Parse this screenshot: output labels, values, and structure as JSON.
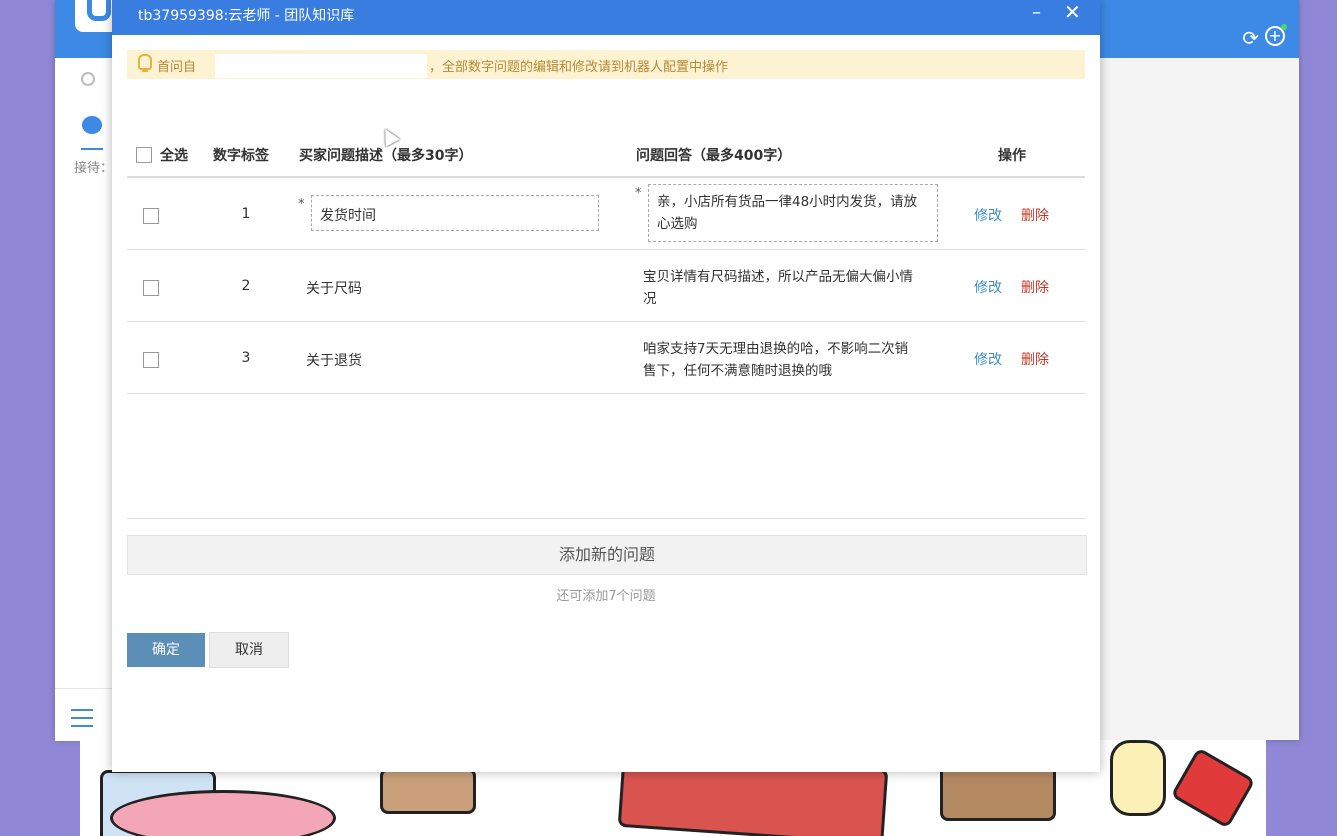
{
  "dialog": {
    "title": "tb37959398:云老师 - 团队知识库",
    "minimize_glyph": "–",
    "close_glyph": "✕"
  },
  "notice": {
    "prefix": "首问自",
    "suffix": "，全部数字问题的编辑和修改请到机器人配置中操作"
  },
  "table": {
    "headers": {
      "select_all": "全选",
      "number_tag": "数字标签",
      "question": "买家问题描述（最多30字）",
      "answer": "问题回答（最多400字）",
      "actions": "操作"
    },
    "required_mark": "*",
    "edit_label": "修改",
    "delete_label": "删除",
    "rows": [
      {
        "num": "1",
        "question": "发货时间",
        "answer": "亲，小店所有货品一律48小时内发货，请放心选购",
        "editing": true
      },
      {
        "num": "2",
        "question": "关于尺码",
        "answer": "宝贝详情有尺码描述，所以产品无偏大偏小情况",
        "editing": false
      },
      {
        "num": "3",
        "question": "关于退货",
        "answer": "咱家支持7天无理由退换的哈，不影响二次销售下，任何不满意随时退换的哦",
        "editing": false
      }
    ]
  },
  "add_button": "添加新的问题",
  "remaining_text": "还可添加7个问题",
  "confirm_button": "确定",
  "cancel_button": "取消",
  "background": {
    "reception_label": "接待：",
    "refresh_glyph": "⟳",
    "add_glyph": "+"
  },
  "colors": {
    "titlebar": "#3a7de0",
    "edit_link": "#3d8ec9",
    "delete_link": "#c0392b",
    "confirm_button": "#5c8fb8"
  }
}
